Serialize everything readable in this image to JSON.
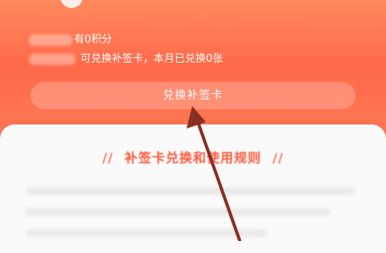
{
  "header": {
    "points_text": "有0积分",
    "redeem_status_text": "可兑换补签卡，本月已兑换0张"
  },
  "exchange_button": {
    "label": "兑换补签卡"
  },
  "rules": {
    "title": "补签卡兑换和使用规则",
    "slash_left": "//",
    "slash_right": "//"
  },
  "colors": {
    "header_start": "#ff8a5e",
    "header_end": "#ff6a4a",
    "accent": "#ff5a3c",
    "arrow": "#8b2e22"
  }
}
